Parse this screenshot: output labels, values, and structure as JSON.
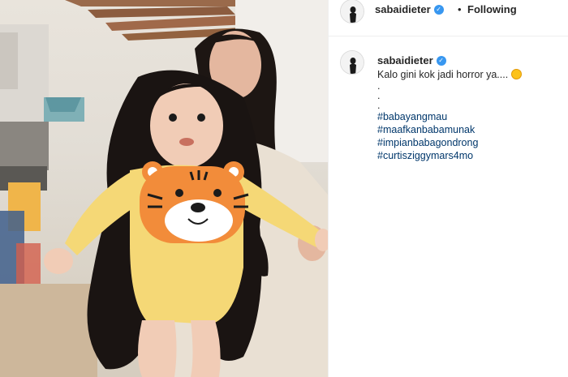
{
  "post": {
    "username": "sabaidieter",
    "verified": true,
    "dot": "•",
    "follow_label": "Following"
  },
  "caption": {
    "username": "sabaidieter",
    "text": "Kalo gini kok jadi horror ya....",
    "emoji": "rolling-on-floor-laughing",
    "periods": [
      ".",
      ".",
      "."
    ],
    "hashtags": [
      "#babayangmau",
      "#maafkanbabamunak",
      "#impianbabagondrong",
      "#curtisziggymars4mo"
    ]
  },
  "colors": {
    "link": "#00376b",
    "verified": "#3897f0",
    "border": "#efefef"
  }
}
